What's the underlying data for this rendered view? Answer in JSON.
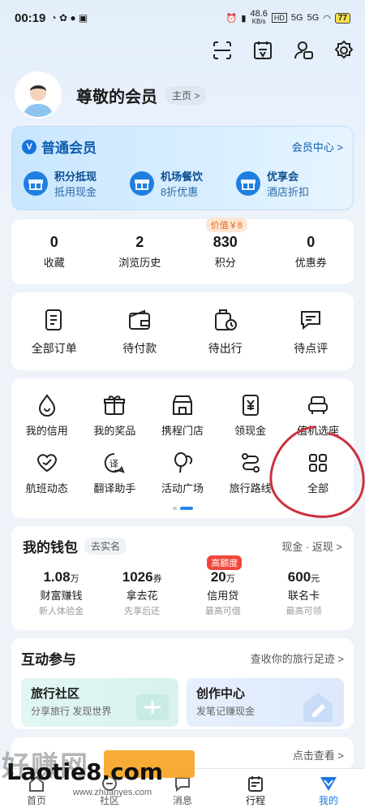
{
  "status": {
    "time": "00:19",
    "speed": "48.6",
    "speed_unit": "KB/s",
    "hd": "HD",
    "net1": "5G",
    "net2": "5G",
    "battery": "77"
  },
  "profile": {
    "name": "尊敬的会员",
    "home_chip": "主页 >"
  },
  "member": {
    "level": "普通会员",
    "center_link": "会员中心 >",
    "perks": [
      {
        "title": "积分抵现",
        "sub": "抵用现金"
      },
      {
        "title": "机场餐饮",
        "sub": "8折优惠"
      },
      {
        "title": "优享会",
        "sub": "酒店折扣"
      }
    ]
  },
  "stats": [
    {
      "value": "0",
      "label": "收藏"
    },
    {
      "value": "2",
      "label": "浏览历史"
    },
    {
      "value": "830",
      "label": "积分",
      "tag": "价值￥8"
    },
    {
      "value": "0",
      "label": "优惠券"
    }
  ],
  "orders": [
    {
      "label": "全部订单",
      "icon": "order-icon"
    },
    {
      "label": "待付款",
      "icon": "wallet-icon"
    },
    {
      "label": "待出行",
      "icon": "luggage-icon"
    },
    {
      "label": "待点评",
      "icon": "comment-icon"
    }
  ],
  "services_row1": [
    {
      "label": "我的信用",
      "icon": "credit-icon"
    },
    {
      "label": "我的奖品",
      "icon": "gift-icon"
    },
    {
      "label": "携程门店",
      "icon": "store-icon"
    },
    {
      "label": "领现金",
      "icon": "cash-icon"
    },
    {
      "label": "值机选座",
      "icon": "seat-icon"
    }
  ],
  "services_row2": [
    {
      "label": "航班动态",
      "icon": "flight-heart-icon"
    },
    {
      "label": "翻译助手",
      "icon": "translate-icon"
    },
    {
      "label": "活动广场",
      "icon": "balloon-icon"
    },
    {
      "label": "旅行路线",
      "icon": "route-icon"
    },
    {
      "label": "全部",
      "icon": "grid-icon"
    }
  ],
  "wallet": {
    "title": "我的钱包",
    "chip": "去实名",
    "link": "现金 · 返现 >",
    "items": [
      {
        "value": "1.08",
        "unit": "万",
        "label": "财富赚钱",
        "sub": "新人体验金"
      },
      {
        "value": "1026",
        "unit": "券",
        "label": "拿去花",
        "sub": "先享后还"
      },
      {
        "value": "20",
        "unit": "万",
        "label": "信用贷",
        "sub": "最高可借",
        "tag": "高额度"
      },
      {
        "value": "600",
        "unit": "元",
        "label": "联名卡",
        "sub": "最高可领"
      }
    ]
  },
  "interact": {
    "title": "互动参与",
    "link": "查收你的旅行足迹 >",
    "cards": [
      {
        "title": "旅行社区",
        "sub": "分享旅行 发现世界"
      },
      {
        "title": "创作中心",
        "sub": "发笔记赚现金"
      }
    ]
  },
  "peek": {
    "link": "点击查看 >"
  },
  "tabs": [
    {
      "label": "首页"
    },
    {
      "label": "社区"
    },
    {
      "label": "消息"
    },
    {
      "label": "行程"
    },
    {
      "label": "我的"
    }
  ],
  "watermark": {
    "cn": "好赚网",
    "en": "Laotie8.com",
    "url": "www.zhuanyes.com"
  },
  "colors": {
    "accent": "#1a78e0",
    "member_text": "#0e5dae",
    "hot": "#f0473c",
    "value_tag": "#e06a1e",
    "scribble": "#c9323c"
  }
}
